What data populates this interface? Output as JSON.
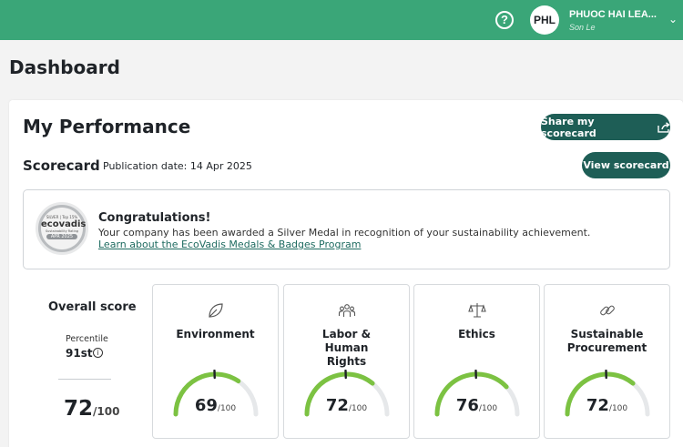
{
  "topbar": {
    "user_initials": "PHL",
    "user_name": "PHUOC HAI LEA...",
    "user_sub": "Son Le"
  },
  "page": {
    "title": "Dashboard"
  },
  "performance": {
    "title": "My Performance",
    "share_label": "Share my scorecard",
    "scorecard_label": "Scorecard",
    "publication_date": "Publication date: 14 Apr 2025",
    "view_label": "View scorecard"
  },
  "congrats": {
    "title": "Congratulations!",
    "text": "Your company has been awarded a Silver Medal in recognition of your sustainability achievement.",
    "link": "Learn about the EcoVadis Medals & Badges Program",
    "badge_top": "SILVER | Top 15%",
    "badge_brand": "ecovadis",
    "badge_sub": "Sustainability Rating",
    "badge_date": "APR 2025"
  },
  "overall": {
    "label": "Overall score",
    "percentile_label": "Percentile",
    "percentile_value": "91st",
    "score": "72",
    "max": "/100"
  },
  "themes": [
    {
      "name": "Environment",
      "score": 69,
      "max": "/100",
      "icon": "leaf-icon"
    },
    {
      "name": "Labor & Human Rights",
      "score": 72,
      "max": "/100",
      "icon": "people-icon"
    },
    {
      "name": "Ethics",
      "score": 76,
      "max": "/100",
      "icon": "scales-icon"
    },
    {
      "name": "Sustainable Procurement",
      "score": 72,
      "max": "/100",
      "icon": "chain-link-icon"
    }
  ],
  "colors": {
    "brand": "#3aa678",
    "button": "#1e5e56",
    "gauge_fill": "#7cc242",
    "gauge_track": "#e6e8ea"
  }
}
